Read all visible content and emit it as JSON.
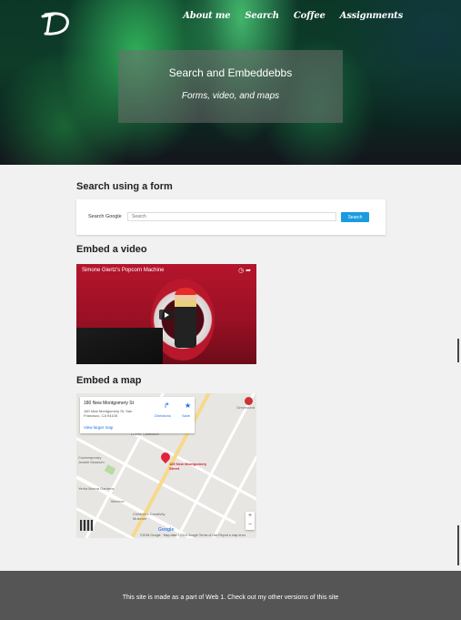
{
  "nav": {
    "items": [
      "About me",
      "Search",
      "Coffee",
      "Assignments"
    ]
  },
  "hero": {
    "title": "Search and Embeddebbs",
    "subtitle": "Forms, video, and maps"
  },
  "sections": {
    "form": {
      "heading": "Search using a form",
      "label": "Search Google",
      "placeholder": "Search",
      "button": "Search"
    },
    "video": {
      "heading": "Embed a video",
      "title": "Simone Giertz's Popcorn Machine"
    },
    "map": {
      "heading": "Embed a map",
      "place": "180 New Montgomery St",
      "address": "180 New Montgomery St, San Francisco, CA 94105",
      "larger": "View larger map",
      "directions": "Directions",
      "save": "Save",
      "pin_label": "180 New Montgomery Street",
      "poi_1": "Luxury Collection",
      "poi_2": "Yerba Buena Gardens",
      "poi_3": "Contemporary Jewish Museum",
      "poi_4": "Children's Creativity Museum",
      "poi_5": "Greyhound",
      "poi_6": "Metreon",
      "footer": "©2018 Google · Map data ©2018 Google   Terms of Use   Report a map error"
    }
  },
  "footer": {
    "text": "This site is made as a part of Web 1. Check out my other versions of this site"
  },
  "colors": {
    "search_button": "#1a9be0",
    "footer_bg": "#555555",
    "page_bg": "#f1f1f1"
  }
}
